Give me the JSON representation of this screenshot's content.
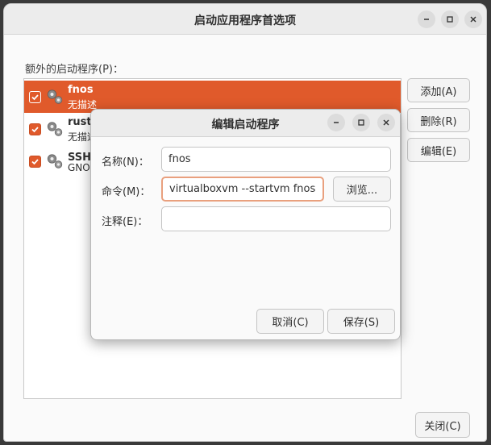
{
  "main_window": {
    "title": "启动应用程序首选项",
    "section_label": "额外的启动程序(P)：",
    "buttons": {
      "add": "添加(A)",
      "remove": "删除(R)",
      "edit": "编辑(E)",
      "close": "关闭(C)"
    },
    "window_controls": [
      "minimize-icon",
      "maximize-icon",
      "close-icon"
    ]
  },
  "startup_items": [
    {
      "name": "fnos",
      "description": "无描述",
      "checked": true,
      "selected": true
    },
    {
      "name": "rusto",
      "description": "无描述",
      "checked": true,
      "selected": false
    },
    {
      "name": "SSH 密",
      "description": "GNOM",
      "checked": true,
      "selected": false
    }
  ],
  "dialog": {
    "title": "编辑启动程序",
    "name_label": "名称(N)：",
    "name_value": "fnos",
    "command_label": "命令(M)：",
    "command_value": "virtualboxvm --startvm fnos",
    "comment_label": "注释(E)：",
    "comment_value": "",
    "browse_label": "浏览...",
    "cancel_label": "取消(C)",
    "save_label": "保存(S)"
  },
  "colors": {
    "accent": "#e05a2b",
    "focus_border": "#e9a07e"
  }
}
